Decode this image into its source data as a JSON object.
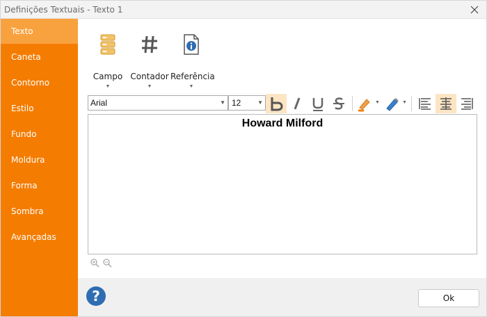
{
  "window": {
    "title": "Definições Textuais - Texto 1"
  },
  "sidebar": {
    "items": [
      {
        "label": "Texto",
        "active": true
      },
      {
        "label": "Caneta"
      },
      {
        "label": "Contorno"
      },
      {
        "label": "Estilo"
      },
      {
        "label": "Fundo"
      },
      {
        "label": "Moldura"
      },
      {
        "label": "Forma"
      },
      {
        "label": "Sombra"
      },
      {
        "label": "Avançadas"
      }
    ]
  },
  "ribbon": {
    "campo": {
      "label": "Campo",
      "icon": "database-icon"
    },
    "contador": {
      "label": "Contador",
      "icon": "hash-icon"
    },
    "referencia": {
      "label": "Referência",
      "icon": "info-document-icon"
    }
  },
  "toolbar": {
    "font": "Arial",
    "size": "12"
  },
  "editor": {
    "text": "Howard Milford"
  },
  "footer": {
    "ok_label": "Ok"
  },
  "colors": {
    "sidebar": "#f47c00",
    "sidebar_active": "#f8a23f",
    "active_button_bg": "#fde5c4"
  }
}
